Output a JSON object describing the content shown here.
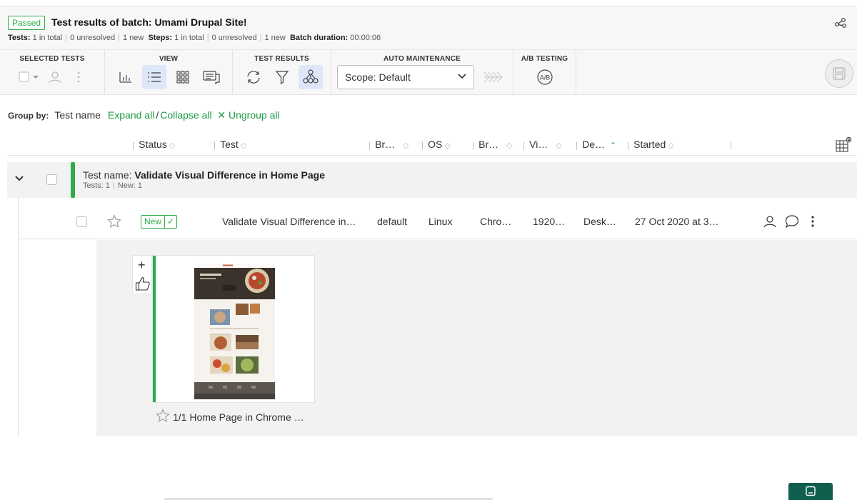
{
  "header": {
    "status_badge": "Passed",
    "title_prefix": "Test results of batch: ",
    "title_name": "Umami Drupal Site!",
    "stats": {
      "tests_label": "Tests:",
      "tests_total": "1 in total",
      "tests_unresolved": "0 unresolved",
      "tests_new": "1 new",
      "steps_label": "Steps:",
      "steps_total": "1 in total",
      "steps_unresolved": "0 unresolved",
      "steps_new": "1 new",
      "duration_label": "Batch duration:",
      "duration_value": "00:00:06"
    },
    "share_icon": "share-icon"
  },
  "toolbar": {
    "selected_tests_label": "SELECTED TESTS",
    "view_label": "VIEW",
    "test_results_label": "TEST RESULTS",
    "auto_maintenance_label": "AUTO MAINTENANCE",
    "ab_testing_label": "A/B TESTING",
    "scope_value": "Scope: Default",
    "ab_icon_text": "A/B",
    "accent_color": "#1f9b46",
    "active_bg": "#dde7f8"
  },
  "groupby": {
    "label": "Group by:",
    "value": "Test name",
    "expand_all": "Expand all",
    "separator": "/",
    "collapse_all": "Collapse all",
    "ungroup_all": "✕ Ungroup all"
  },
  "columns": {
    "status": "Status",
    "test": "Test",
    "browser": "Br…",
    "os": "OS",
    "browser2": "Br…",
    "viewport": "Vi…",
    "device": "De…",
    "started": "Started"
  },
  "group": {
    "title_prefix": "Test name: ",
    "title_name": "Validate Visual Difference in Home Page",
    "tests_count": "Tests: 1",
    "new_count": "New: 1"
  },
  "test_row": {
    "status_badge": "New",
    "status_tick": "✓",
    "test_name": "Validate Visual Difference in…",
    "branch": "default",
    "os": "Linux",
    "browser": "Chro…",
    "viewport": "1920…",
    "device": "Desk…",
    "started": "27 Oct 2020 at 3…"
  },
  "step": {
    "caption": "1/1 Home Page in Chrome …",
    "add_symbol": "+"
  }
}
